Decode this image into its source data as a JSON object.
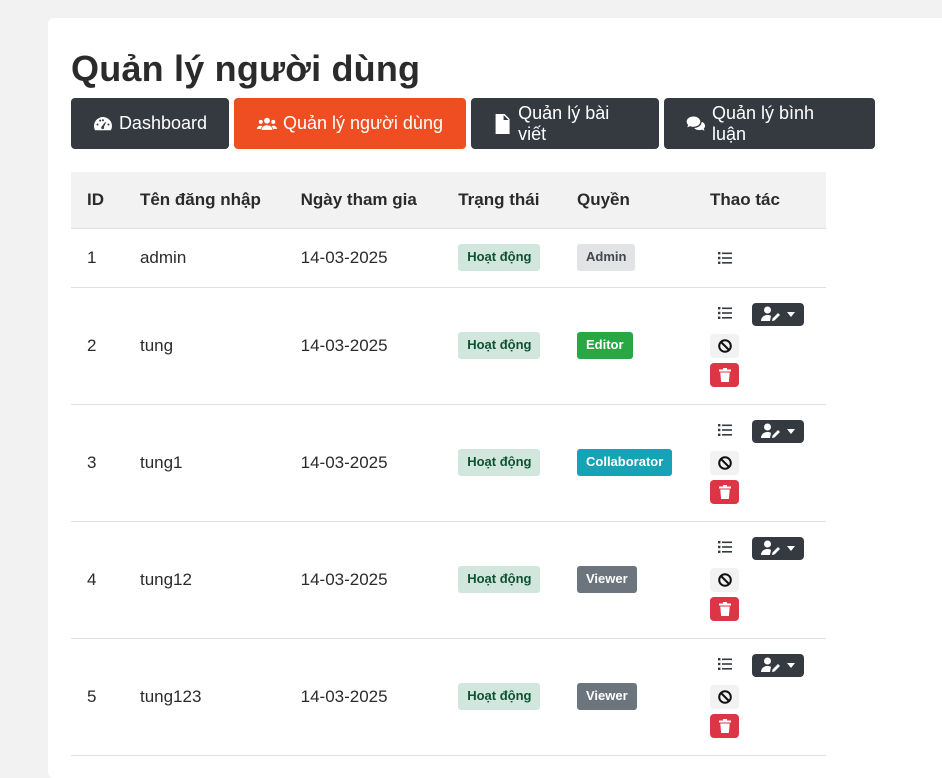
{
  "title": "Quản lý người dùng",
  "nav": [
    {
      "label": "Dashboard",
      "icon": "dashboard-icon"
    },
    {
      "label": "Quản lý người dùng",
      "icon": "users-icon",
      "active": true
    },
    {
      "label": "Quản lý bài viết",
      "icon": "document-icon"
    },
    {
      "label": "Quản lý bình luận",
      "icon": "comments-icon"
    }
  ],
  "colors": {
    "accent": "#ef4e23",
    "dark": "#343a40",
    "danger": "#dc3545"
  },
  "table": {
    "headers": [
      "ID",
      "Tên đăng nhập",
      "Ngày tham gia",
      "Trạng thái",
      "Quyền",
      "Thao tác"
    ],
    "rows": [
      {
        "id": "1",
        "username": "admin",
        "joined": "14-03-2025",
        "status": "Hoạt động",
        "role": "Admin"
      },
      {
        "id": "2",
        "username": "tung",
        "joined": "14-03-2025",
        "status": "Hoạt động",
        "role": "Editor"
      },
      {
        "id": "3",
        "username": "tung1",
        "joined": "14-03-2025",
        "status": "Hoạt động",
        "role": "Collaborator"
      },
      {
        "id": "4",
        "username": "tung12",
        "joined": "14-03-2025",
        "status": "Hoạt động",
        "role": "Viewer"
      },
      {
        "id": "5",
        "username": "tung123",
        "joined": "14-03-2025",
        "status": "Hoạt động",
        "role": "Viewer"
      }
    ]
  }
}
